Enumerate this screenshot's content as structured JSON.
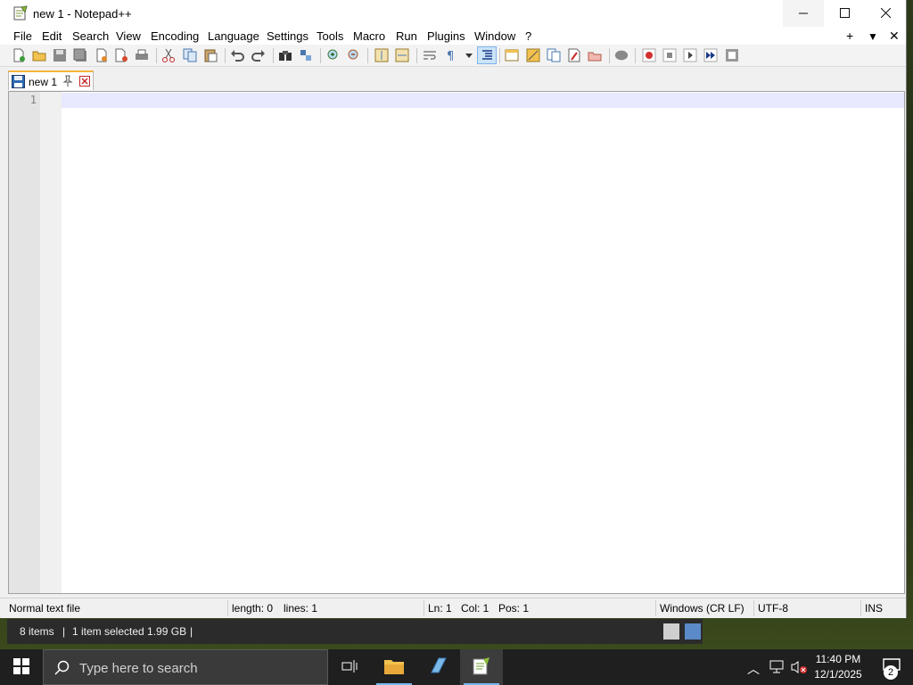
{
  "window": {
    "title": "new 1 - Notepad++",
    "minimize_icon": "minimize-icon",
    "maximize_icon": "maximize-icon",
    "close_icon": "close-icon"
  },
  "menu": {
    "items": [
      "File",
      "Edit",
      "Search",
      "View",
      "Encoding",
      "Language",
      "Settings",
      "Tools",
      "Macro",
      "Run",
      "Plugins",
      "Window",
      "?"
    ],
    "right_controls": [
      "+",
      "▼",
      "✕"
    ]
  },
  "toolbar": {
    "icons": [
      "new-file-icon",
      "open-file-icon",
      "save-icon",
      "save-all-icon",
      "close-icon",
      "close-all-icon",
      "print-icon",
      "cut-icon",
      "copy-icon",
      "paste-icon",
      "undo-icon",
      "redo-icon",
      "find-icon",
      "replace-icon",
      "zoom-in-icon",
      "zoom-out-icon",
      "sync-vertical-icon",
      "sync-horizontal-icon",
      "word-wrap-icon",
      "show-all-characters-icon",
      "indent-guide-icon",
      "user-defined-language-icon",
      "document-map-icon",
      "function-list-icon",
      "folder-as-workspace-icon",
      "monitoring-icon",
      "record-macro-icon",
      "stop-recording-icon",
      "playback-macro-icon",
      "run-macro-multiple-icon",
      "save-macro-icon"
    ]
  },
  "tabs": [
    {
      "label": "new 1",
      "icon": "file-saved-icon",
      "pin_icon": "pin-icon",
      "close_icon": "close-tab-icon"
    }
  ],
  "editor": {
    "line_numbers": [
      "1"
    ],
    "content": ""
  },
  "statusbar": {
    "file_type": "Normal text file",
    "length": "length: 0",
    "lines": "lines: 1",
    "ln": "Ln: 1",
    "col": "Col: 1",
    "pos": "Pos: 1",
    "eol": "Windows (CR LF)",
    "encoding": "UTF-8",
    "mode": "INS"
  },
  "explorer_strip": {
    "items": "8 items",
    "selected": "1 item selected  1.99 GB"
  },
  "taskbar": {
    "search_placeholder": "Type here to search",
    "time": "11:40 PM",
    "date": "12/1/2025",
    "notification_count": "2"
  }
}
